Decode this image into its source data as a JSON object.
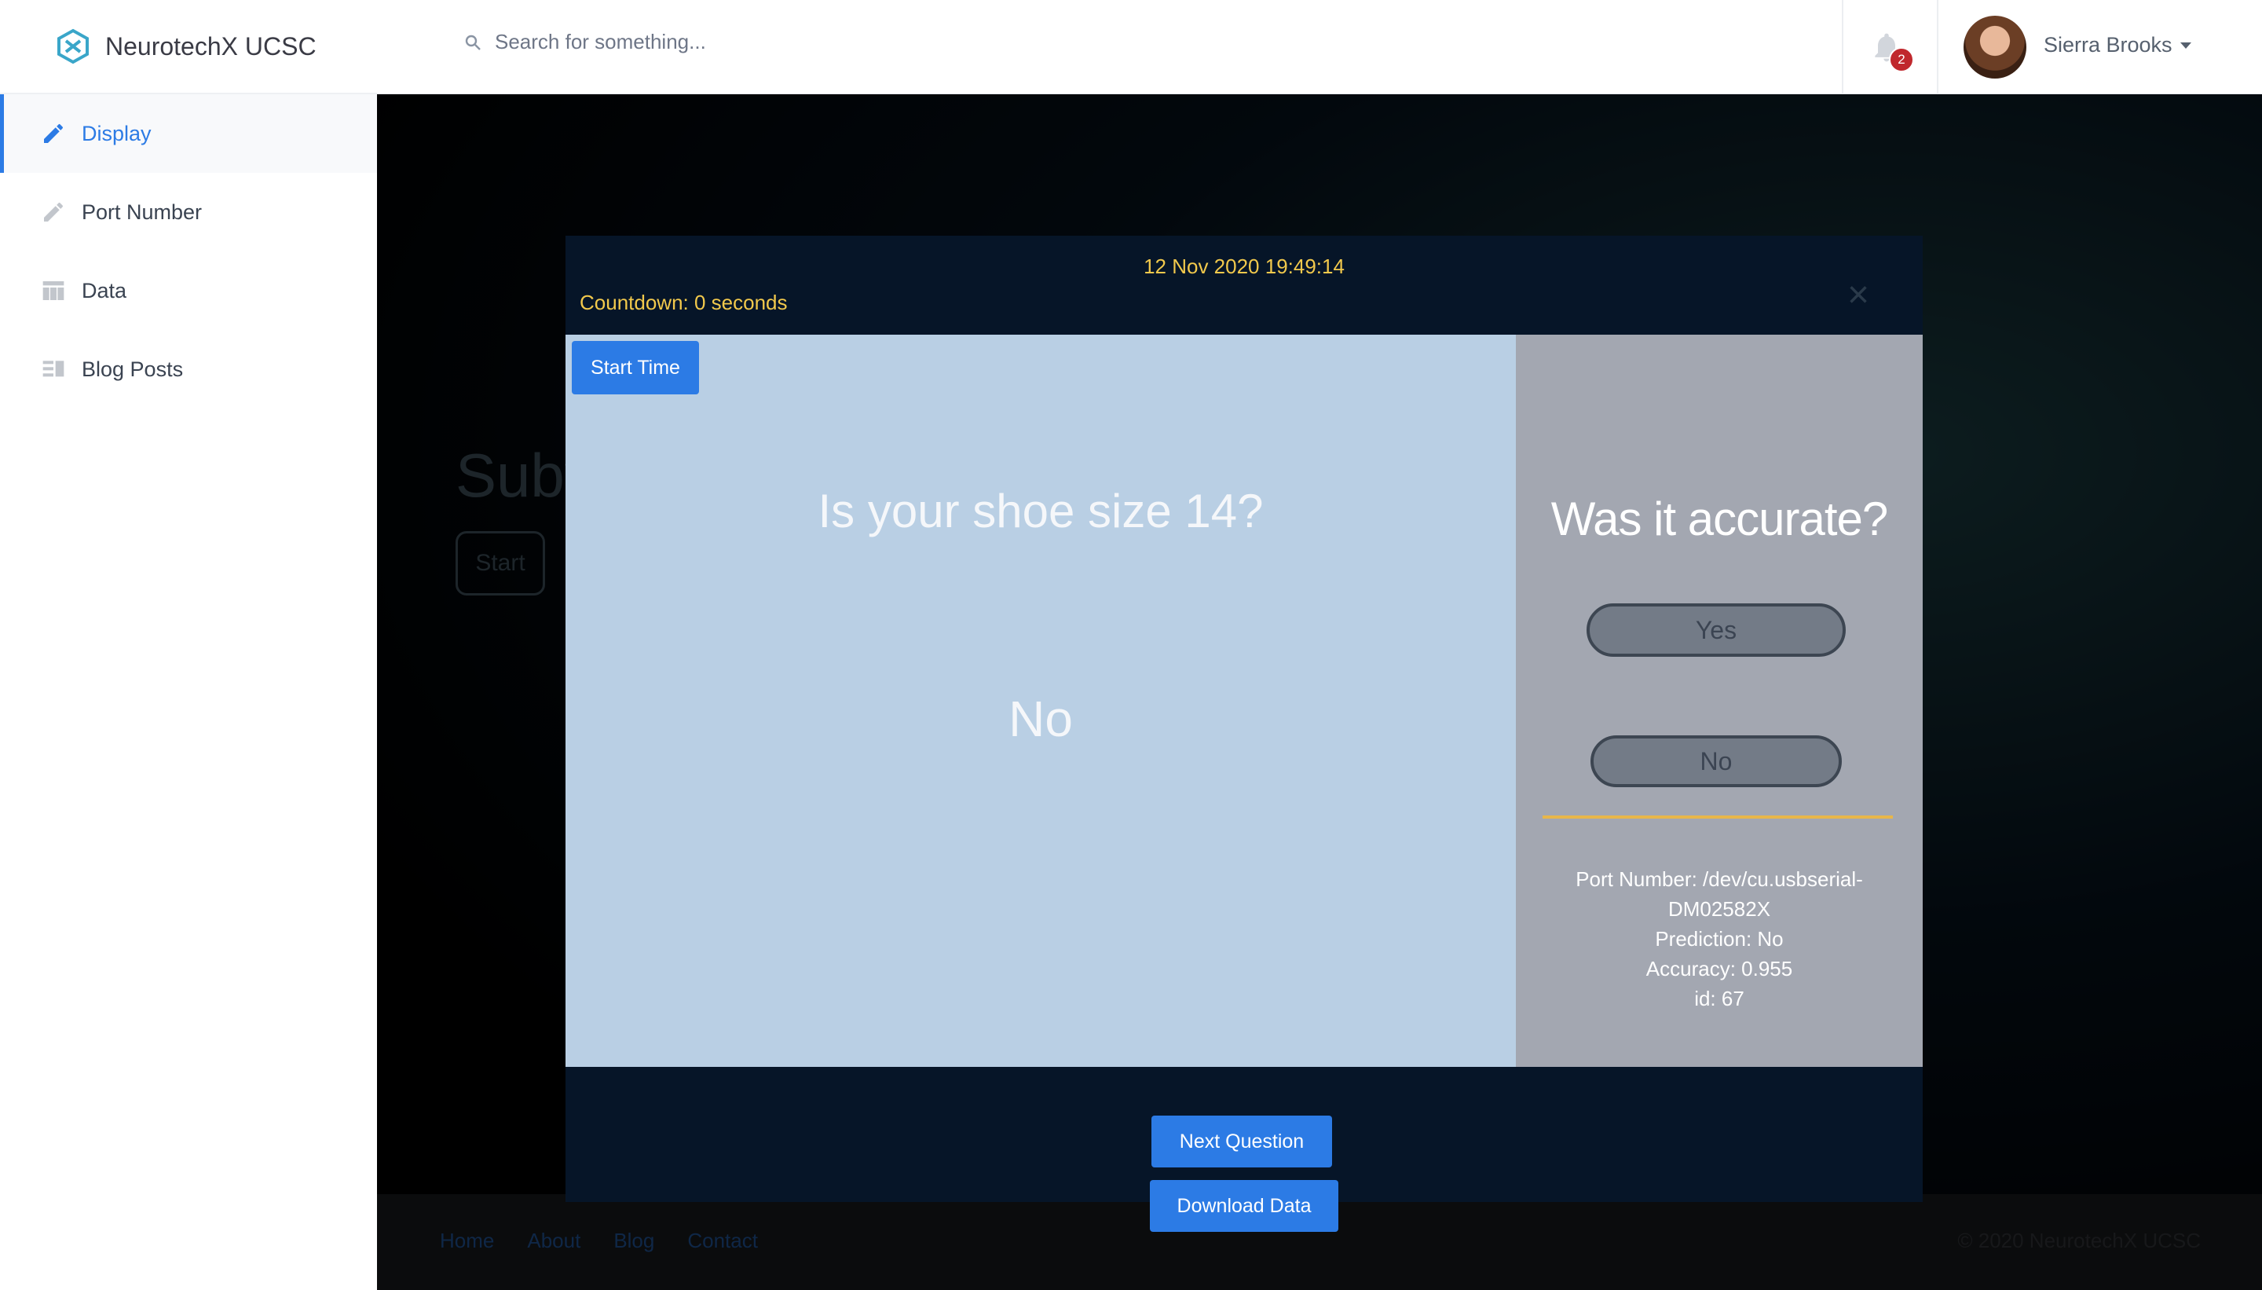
{
  "brand": {
    "name": "NeurotechX UCSC",
    "logo_icon": "neurotechx-logo-icon"
  },
  "sidebar": {
    "items": [
      {
        "label": "Display",
        "icon": "pencil-icon",
        "active": true
      },
      {
        "label": "Port Number",
        "icon": "pencil-icon",
        "active": false
      },
      {
        "label": "Data",
        "icon": "table-icon",
        "active": false
      },
      {
        "label": "Blog Posts",
        "icon": "list-icon",
        "active": false
      }
    ]
  },
  "topbar": {
    "search_placeholder": "Search for something...",
    "notifications_count": "2",
    "user_name": "Sierra Brooks"
  },
  "background": {
    "title": "Subv",
    "start_label": "Start",
    "footer_links": [
      "Home",
      "About",
      "Blog",
      "Contact"
    ],
    "copyright": "© 2020 NeurotechX UCSC"
  },
  "modal": {
    "datetime": "12 Nov 2020 19:49:14",
    "countdown": "Countdown: 0 seconds",
    "close_label": "×",
    "start_time_label": "Start Time",
    "question": "Is your shoe size 14?",
    "answer": "No",
    "accuracy_prompt": "Was it accurate?",
    "yes_label": "Yes",
    "no_label": "No",
    "info": {
      "port_line1": "Port Number: /dev/cu.usbserial-",
      "port_line2": "DM02582X",
      "prediction": "Prediction: No",
      "accuracy": "Accuracy: 0.955",
      "id": "id: 67"
    },
    "next_label": "Next Question",
    "download_label": "Download Data"
  },
  "colors": {
    "accent": "#2c7be5",
    "modal_bg": "#061528",
    "question_bg": "#b9cfe4",
    "side_bg": "#a3a7b1",
    "highlight_text": "#f2c94c",
    "badge": "#c0282d"
  }
}
